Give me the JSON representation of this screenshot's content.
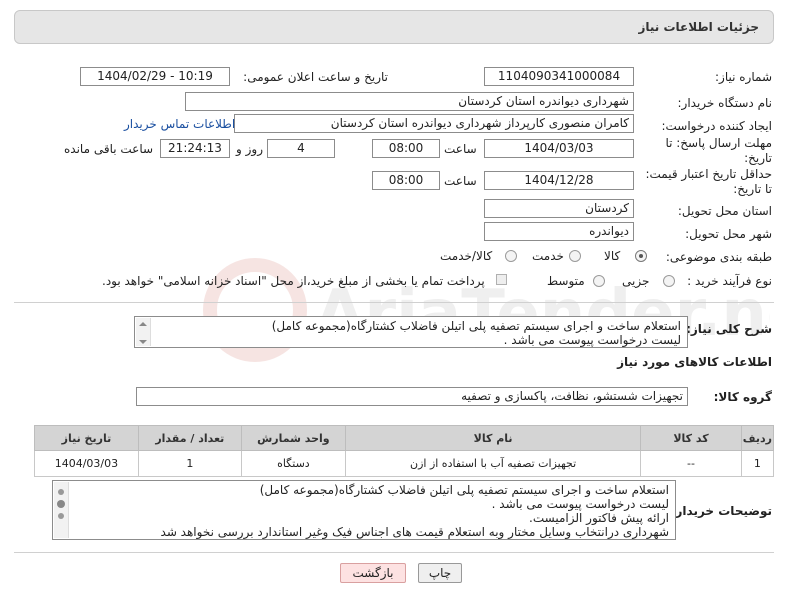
{
  "header": {
    "title": "جزئیات اطلاعات نیاز"
  },
  "form": {
    "need_number_label": "شماره نیاز:",
    "need_number": "1104090341000084",
    "announce_label": "تاریخ و ساعت اعلان عمومی:",
    "announce_value": "1404/02/29 - 10:19",
    "buyer_org_label": "نام دستگاه خریدار:",
    "buyer_org": "شهرداری دیواندره استان کردستان",
    "creator_label": "ایجاد کننده درخواست:",
    "creator": "کامران منصوری کارپرداز شهرداری دیواندره استان کردستان",
    "contact_link": "اطلاعات تماس خریدار",
    "deadline_label_1": "مهلت ارسال پاسخ: تا",
    "deadline_label_2": "تاریخ:",
    "deadline_date": "1404/03/03",
    "time_label": "ساعت",
    "deadline_time": "08:00",
    "days_value": "4",
    "days_label": "روز و",
    "remaining_time": "21:24:13",
    "remaining_label": "ساعت باقی مانده",
    "validity_label_1": "حداقل تاریخ اعتبار قیمت:",
    "validity_label_2": "تا تاریخ:",
    "validity_date": "1404/12/28",
    "validity_time": "08:00",
    "province_label": "استان محل تحویل:",
    "province": "کردستان",
    "city_label": "شهر محل تحویل:",
    "city": "دیواندره",
    "category_label": "طبقه بندی موضوعی:",
    "category_options": [
      "کالا",
      "خدمت",
      "کالا/خدمت"
    ],
    "process_label": "نوع فرآیند خرید :",
    "process_options": [
      "جزیی",
      "متوسط"
    ],
    "payment_note": "پرداخت تمام یا بخشی از مبلغ خرید،از محل \"اسناد خزانه اسلامی\" خواهد بود."
  },
  "summary": {
    "label": "شرح کلی نیاز:",
    "line1": "استعلام ساخت و اجرای سیستم تصفیه پلی اتیلن فاضلاب کشتارگاه(مجموعه کامل)",
    "line2": "لیست درخواست پیوست می باشد ."
  },
  "goods": {
    "section_title": "اطلاعات کالاهای مورد نیاز",
    "group_label": "گروه کالا:",
    "group_value": "تجهیزات شستشو، نظافت، پاکسازی و تصفیه",
    "columns": [
      "ردیف",
      "کد کالا",
      "نام کالا",
      "واحد شمارش",
      "تعداد / مقدار",
      "تاریخ نیاز"
    ],
    "rows": [
      {
        "row": "1",
        "code": "--",
        "name": "تجهیزات تصفیه آب با استفاده از ازن",
        "unit": "دستگاه",
        "qty": "1",
        "date": "1404/03/03"
      }
    ]
  },
  "buyer_notes": {
    "label": "توضیحات خریدار:",
    "lines": [
      "استعلام ساخت و اجرای سیستم تصفیه پلی اتیلن فاضلاب کشتارگاه(مجموعه کامل)",
      "لیست درخواست پیوست می باشد .",
      "ارائه پیش فاکتور الزامیست.",
      "شهرداری درانتخاب وسایل مختار وبه استعلام قیمت های اجناس فیک وغیر استاندارد بررسی نخواهد شد"
    ]
  },
  "buttons": {
    "print": "چاپ",
    "back": "بازگشت"
  },
  "watermark": {
    "text": "AriaTender.net"
  }
}
